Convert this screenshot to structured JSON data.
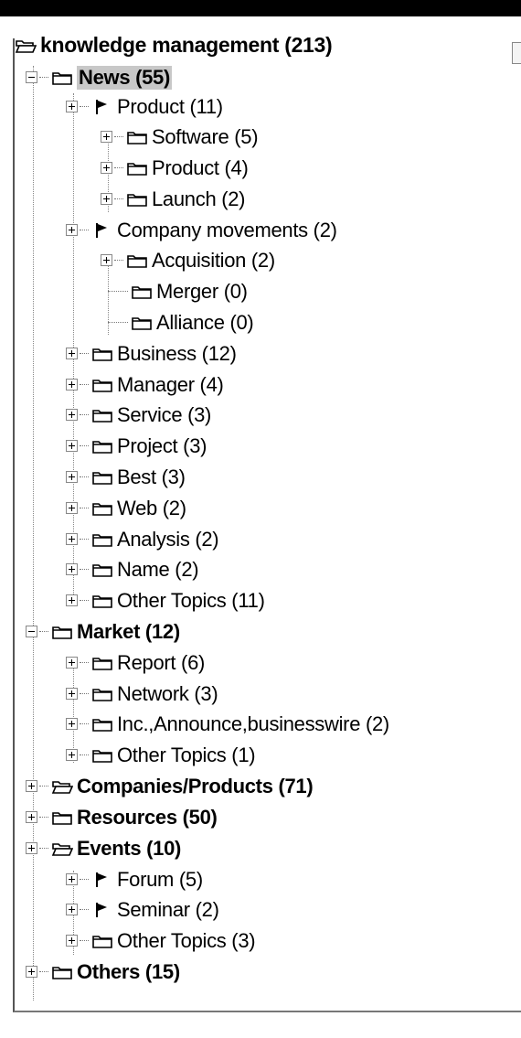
{
  "tree": {
    "root": {
      "label": "knowledge management (213)",
      "icon": "open-folder-icon"
    },
    "news": {
      "label": "News (55)",
      "icon": "folder-icon"
    },
    "news_product": {
      "label": "Product (11)",
      "icon": "flag-icon"
    },
    "software": {
      "label": "Software (5)",
      "icon": "folder-icon"
    },
    "product_sub": {
      "label": "Product (4)",
      "icon": "folder-icon"
    },
    "launch": {
      "label": "Launch (2)",
      "icon": "folder-icon"
    },
    "company_movements": {
      "label": "Company movements (2)",
      "icon": "flag-icon"
    },
    "acquisition": {
      "label": "Acquisition (2)",
      "icon": "folder-icon"
    },
    "merger": {
      "label": "Merger (0)",
      "icon": "folder-icon"
    },
    "alliance": {
      "label": "Alliance (0)",
      "icon": "folder-icon"
    },
    "business": {
      "label": "Business (12)",
      "icon": "folder-icon"
    },
    "manager": {
      "label": "Manager (4)",
      "icon": "folder-icon"
    },
    "service": {
      "label": "Service (3)",
      "icon": "folder-icon"
    },
    "project": {
      "label": "Project (3)",
      "icon": "folder-icon"
    },
    "best": {
      "label": "Best (3)",
      "icon": "folder-icon"
    },
    "web": {
      "label": "Web (2)",
      "icon": "folder-icon"
    },
    "analysis": {
      "label": "Analysis (2)",
      "icon": "folder-icon"
    },
    "name": {
      "label": "Name (2)",
      "icon": "folder-icon"
    },
    "news_other": {
      "label": "Other Topics (11)",
      "icon": "folder-icon"
    },
    "market": {
      "label": "Market (12)",
      "icon": "folder-icon"
    },
    "report": {
      "label": "Report (6)",
      "icon": "folder-icon"
    },
    "network": {
      "label": "Network (3)",
      "icon": "folder-icon"
    },
    "inc": {
      "label": "Inc.,Announce,businesswire (2)",
      "icon": "folder-icon"
    },
    "market_other": {
      "label": "Other Topics (1)",
      "icon": "folder-icon"
    },
    "companies": {
      "label": "Companies/Products (71)",
      "icon": "open-folder-icon"
    },
    "resources": {
      "label": "Resources (50)",
      "icon": "folder-icon"
    },
    "events": {
      "label": "Events (10)",
      "icon": "open-folder-icon"
    },
    "forum": {
      "label": "Forum (5)",
      "icon": "flag-icon"
    },
    "seminar": {
      "label": "Seminar (2)",
      "icon": "flag-icon"
    },
    "events_other": {
      "label": "Other Topics (3)",
      "icon": "folder-icon"
    },
    "others": {
      "label": "Others (15)",
      "icon": "folder-icon"
    }
  }
}
